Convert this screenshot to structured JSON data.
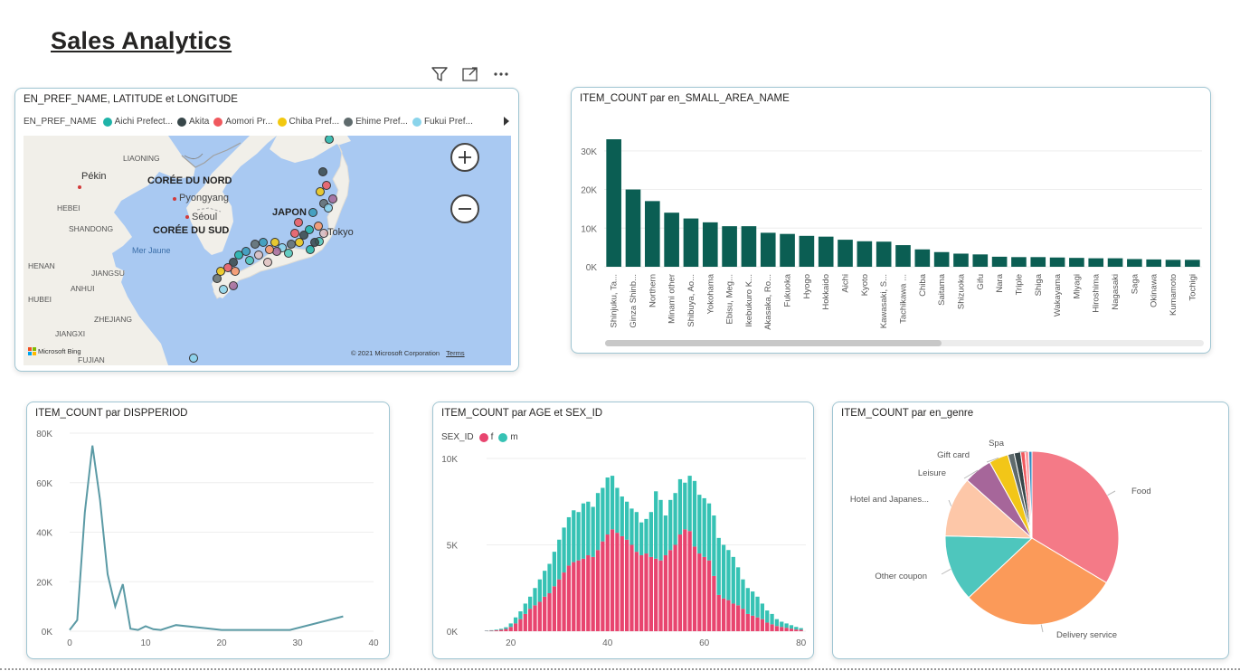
{
  "page": {
    "title": "Sales Analytics"
  },
  "colors": {
    "bar": "#0b5e53",
    "line": "#5b9aa5",
    "female": "#e8456f",
    "male": "#36c2b4"
  },
  "visual_header_icons": [
    "filter-icon",
    "focus-mode-icon",
    "more-options-icon"
  ],
  "map": {
    "title": "EN_PREF_NAME, LATITUDE et LONGITUDE",
    "legend_label": "EN_PREF_NAME",
    "legend_items": [
      {
        "label": "Aichi Prefect...",
        "color": "#1fb3a8"
      },
      {
        "label": "Akita",
        "color": "#374649"
      },
      {
        "label": "Aomori Pr...",
        "color": "#f0595e"
      },
      {
        "label": "Chiba Pref...",
        "color": "#f2c80f"
      },
      {
        "label": "Ehime Pref...",
        "color": "#5f6b6d"
      },
      {
        "label": "Fukui Pref...",
        "color": "#8ad4eb"
      }
    ],
    "place_labels": {
      "liaoning": "LIAONING",
      "pekin": "Pékin",
      "coree_nord": "CORÉE DU NORD",
      "pyongyang": "Pyongyang",
      "hebei": "HEBEI",
      "seoul": "Séoul",
      "shandong": "SHANDONG",
      "coree_sud": "CORÉE DU SUD",
      "japon": "JAPON",
      "tokyo": "Tokyo",
      "mer_jaune": "Mer Jaune",
      "henan": "HENAN",
      "jiangsu": "JIANGSU",
      "anhui": "ANHUI",
      "hubei": "HUBEI",
      "zhejiang": "ZHEJIANG",
      "jiangxi": "JIANGXI",
      "fujian": "FUJIAN"
    },
    "attribution": "© 2021 Microsoft Corporation",
    "terms": "Terms",
    "bing": "Microsoft Bing"
  },
  "bar_visual": {
    "title": "ITEM_COUNT par en_SMALL_AREA_NAME"
  },
  "line_visual": {
    "title": "ITEM_COUNT par DISPPERIOD"
  },
  "age_visual": {
    "title": "ITEM_COUNT par AGE et SEX_ID",
    "legend_label": "SEX_ID",
    "female_label": "f",
    "male_label": "m"
  },
  "pie_visual": {
    "title": "ITEM_COUNT par en_genre"
  },
  "chart_data": [
    {
      "type": "bar",
      "title": "ITEM_COUNT par en_SMALL_AREA_NAME",
      "categories": [
        "Shinjuku, Ta...",
        "Ginza Shinb...",
        "Northern",
        "Minami other",
        "Shibuya, Ao...",
        "Yokohama",
        "Ebisu, Meg...",
        "Ikebukuro K...",
        "Akasaka, Ro...",
        "Fukuoka",
        "Hyogo",
        "Hokkaido",
        "Aichi",
        "Kyoto",
        "Kawasaki, S...",
        "Tachikawa ...",
        "Chiba",
        "Saitama",
        "Shizuoka",
        "Gifu",
        "Nara",
        "Triple",
        "Shiga",
        "Wakayama",
        "Miyagi",
        "Hiroshima",
        "Nagasaki",
        "Saga",
        "Okinawa",
        "Kumamoto",
        "Tochigi"
      ],
      "values": [
        33000,
        20000,
        17000,
        14000,
        12500,
        11500,
        10500,
        10500,
        8800,
        8500,
        8000,
        7800,
        7000,
        6600,
        6500,
        5600,
        4500,
        3800,
        3400,
        3200,
        2600,
        2500,
        2500,
        2400,
        2300,
        2200,
        2200,
        2000,
        1900,
        1800,
        1800
      ],
      "ylim": [
        0,
        35000
      ],
      "yticks": [
        "0K",
        "10K",
        "20K",
        "30K"
      ],
      "ytick_values": [
        0,
        10000,
        20000,
        30000
      ],
      "grid": true
    },
    {
      "type": "line",
      "title": "ITEM_COUNT par DISPPERIOD",
      "x": [
        0,
        1,
        2,
        3,
        4,
        5,
        6,
        7,
        8,
        9,
        10,
        11,
        12,
        14,
        20,
        29,
        36
      ],
      "y": [
        500,
        4500,
        48000,
        75000,
        53000,
        23000,
        10000,
        19000,
        1000,
        500,
        2000,
        800,
        500,
        2500,
        500,
        500,
        6000
      ],
      "xlim": [
        0,
        40
      ],
      "ylim": [
        0,
        80000
      ],
      "xticks": [
        "0",
        "10",
        "20",
        "30",
        "40"
      ],
      "xtick_values": [
        0,
        10,
        20,
        30,
        40
      ],
      "yticks": [
        "0K",
        "20K",
        "40K",
        "60K",
        "80K"
      ],
      "ytick_values": [
        0,
        20000,
        40000,
        60000,
        80000
      ],
      "grid": true
    },
    {
      "type": "bar",
      "stacked": true,
      "title": "ITEM_COUNT par AGE et SEX_ID",
      "x_start": 15,
      "series": [
        {
          "name": "f",
          "values": [
            20,
            30,
            50,
            80,
            130,
            250,
            450,
            700,
            1000,
            1300,
            1500,
            1700,
            2000,
            2200,
            2600,
            3000,
            3400,
            3800,
            4000,
            4100,
            4200,
            4400,
            4300,
            4700,
            5200,
            5600,
            5900,
            5700,
            5500,
            5300,
            5000,
            4600,
            4400,
            4500,
            4300,
            4200,
            4100,
            4400,
            4700,
            5000,
            5600,
            5900,
            5800,
            4900,
            4500,
            4300,
            4100,
            3200,
            2100,
            1900,
            1800,
            1600,
            1500,
            1300,
            1000,
            900,
            800,
            700,
            500,
            400,
            300,
            250,
            200,
            150,
            100,
            80
          ]
        },
        {
          "name": "m",
          "values": [
            20,
            30,
            40,
            60,
            100,
            200,
            350,
            450,
            600,
            700,
            1000,
            1300,
            1500,
            1700,
            2000,
            2300,
            2600,
            2800,
            3000,
            2800,
            3200,
            3100,
            2900,
            3300,
            3100,
            3300,
            3100,
            2600,
            2300,
            2200,
            2100,
            2300,
            1900,
            2000,
            2600,
            3900,
            3500,
            2300,
            2900,
            3000,
            3200,
            2700,
            3200,
            3800,
            3400,
            3400,
            3300,
            3500,
            3300,
            3100,
            2900,
            2700,
            2200,
            1700,
            1500,
            1400,
            1200,
            900,
            700,
            600,
            400,
            300,
            250,
            200,
            150,
            100
          ]
        }
      ],
      "xlim": [
        15,
        81
      ],
      "ylim": [
        0,
        10000
      ],
      "xticks": [
        "20",
        "40",
        "60",
        "80"
      ],
      "xtick_values": [
        20,
        40,
        60,
        80
      ],
      "yticks": [
        "0K",
        "5K",
        "10K"
      ],
      "ytick_values": [
        0,
        5000,
        10000
      ],
      "legend": "top-left",
      "grid": true
    },
    {
      "type": "pie",
      "title": "ITEM_COUNT par en_genre",
      "labels": [
        "Food",
        "Delivery service",
        "Other coupon",
        "Hotel and Japanes...",
        "Leisure",
        "Gift card",
        "",
        "",
        "",
        "Spa",
        ""
      ],
      "values": [
        33.6,
        29.4,
        12.4,
        11.2,
        5.3,
        3.6,
        1.2,
        1.2,
        0.8,
        0.7,
        0.6
      ],
      "colors": [
        "#f47a87",
        "#fb9a59",
        "#4ec6bd",
        "#fdc7a8",
        "#a6669a",
        "#f2c618",
        "#5f6b6d",
        "#374649",
        "#f0595e",
        "#fd9ea5",
        "#3189c0"
      ]
    }
  ]
}
